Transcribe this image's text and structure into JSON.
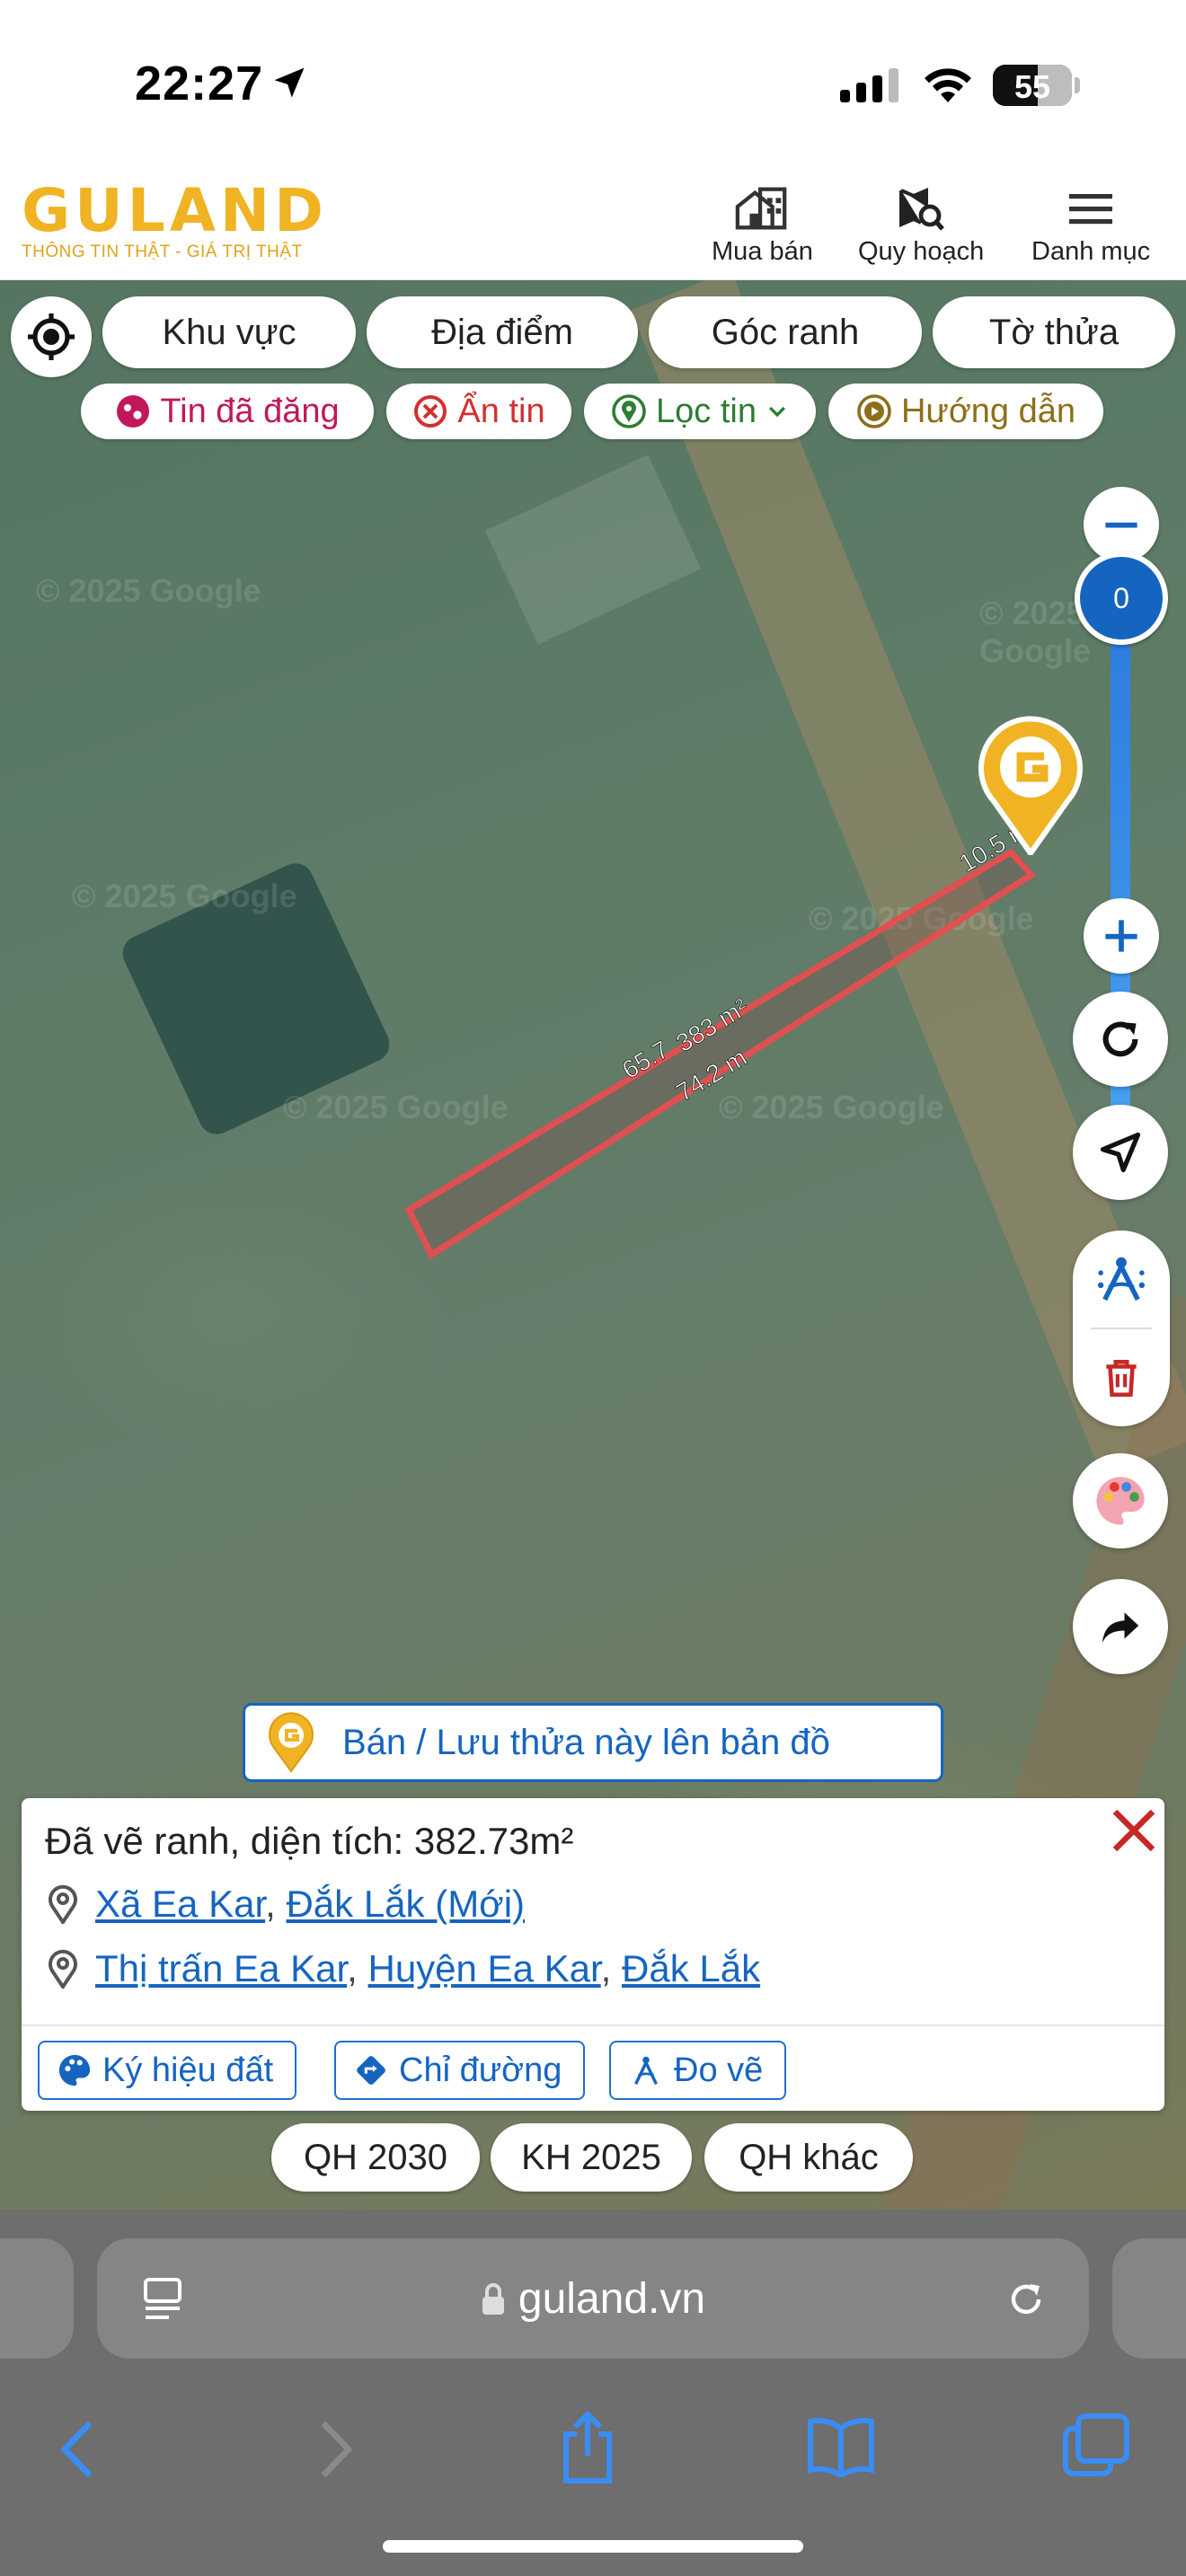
{
  "status_bar": {
    "time": "22:27",
    "battery": "55"
  },
  "header": {
    "logo": "GULAND",
    "slogan": "THÔNG TIN THẬT - GIÁ TRỊ THẬT",
    "nav": [
      {
        "label": "Mua bán",
        "icon": "house-icon"
      },
      {
        "label": "Quy hoạch",
        "icon": "map-search-icon"
      },
      {
        "label": "Danh mục",
        "icon": "menu-icon"
      }
    ]
  },
  "search_tabs": [
    "Khu vực",
    "Địa điểm",
    "Góc ranh",
    "Tờ thửa"
  ],
  "filters": [
    {
      "label": "Tin đã đăng",
      "color": "#c2185b",
      "icon": "posted-icon"
    },
    {
      "label": "Ẩn tin",
      "color": "#d32f2f",
      "icon": "hide-icon"
    },
    {
      "label": "Lọc tin",
      "color": "#2e7d32",
      "icon": "filter-pin-icon"
    },
    {
      "label": "Hướng dẫn",
      "color": "#8d6e1a",
      "icon": "guide-play-icon"
    }
  ],
  "zoom": {
    "value": "0"
  },
  "map": {
    "watermark": "© 2025 Google",
    "measurements": {
      "side_short": "10.5 m",
      "side_long_top": "65.7",
      "side_long_bottom": "74.2 m",
      "area": "383 m²"
    }
  },
  "sell_button": "Bán / Lưu thửa này lên bản đồ",
  "info_panel": {
    "title": "Đã vẽ ranh, diện tích: 382.73m²",
    "address_new": {
      "commune": "Xã Ea Kar",
      "province": "Đắk Lắk (Mới)"
    },
    "address_old": {
      "town": "Thị trấn Ea Kar",
      "district": "Huyện Ea Kar",
      "province": "Đắk Lắk"
    },
    "buttons": [
      "Ký hiệu đất",
      "Chỉ đường",
      "Đo vẽ"
    ]
  },
  "plan_buttons": [
    "QH 2030",
    "KH 2025",
    "QH khác"
  ],
  "safari": {
    "url": "guland.vn"
  },
  "colors": {
    "brand": "#f0b323",
    "accent": "#1565c0",
    "polygon": "#e05050"
  }
}
